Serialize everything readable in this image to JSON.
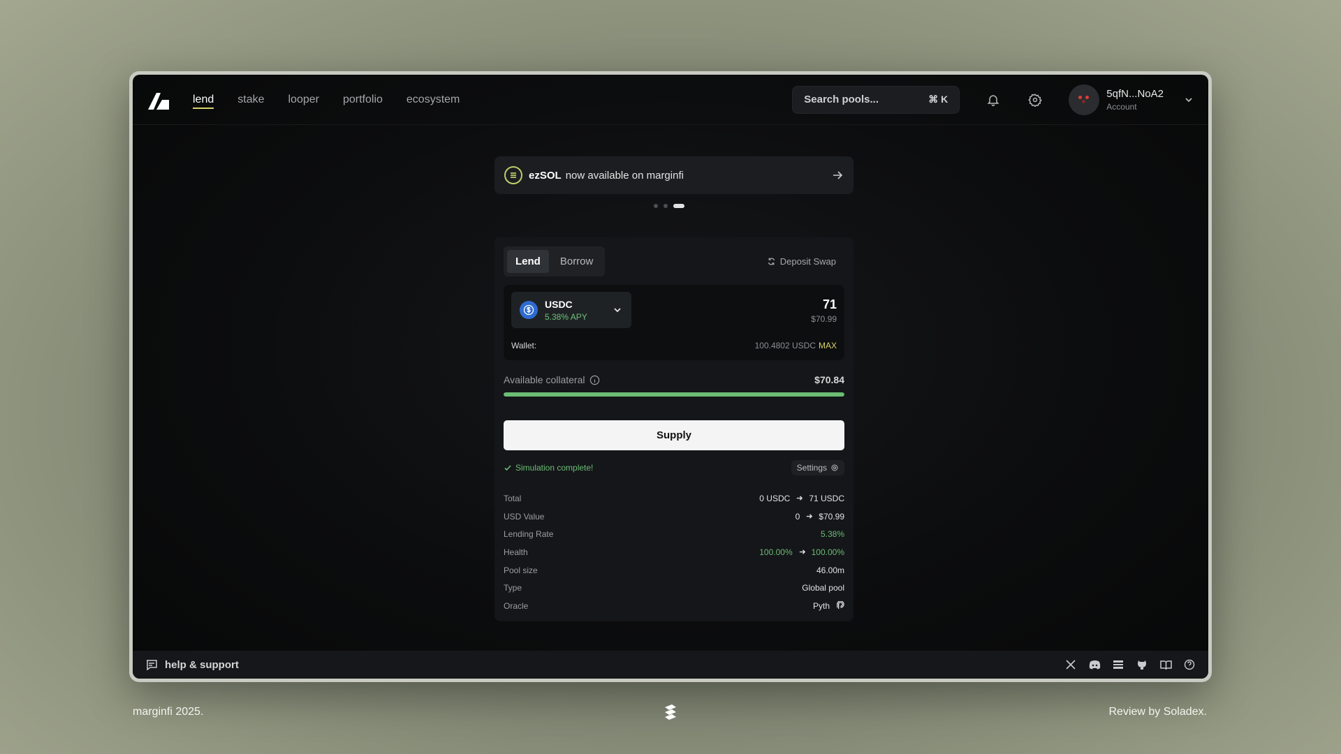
{
  "nav": {
    "items": [
      {
        "label": "lend",
        "active": true
      },
      {
        "label": "stake"
      },
      {
        "label": "looper"
      },
      {
        "label": "portfolio"
      },
      {
        "label": "ecosystem"
      }
    ],
    "search_placeholder": "Search pools...",
    "search_shortcut": "⌘ K",
    "account_name": "5qfN...NoA2",
    "account_sub": "Account"
  },
  "banner": {
    "token": "ezSOL",
    "text": "now available on marginfi"
  },
  "card": {
    "tabs": [
      "Lend",
      "Borrow"
    ],
    "deposit_swap": "Deposit Swap",
    "token": {
      "symbol": "USDC",
      "apy": "5.38% APY"
    },
    "amount": "71",
    "amount_usd": "$70.99",
    "wallet_label": "Wallet:",
    "wallet_balance": "100.4802 USDC",
    "max": "MAX",
    "collateral_label": "Available collateral",
    "collateral_value": "$70.84",
    "collateral_fill_fraction": 1.0,
    "supply_label": "Supply",
    "sim_status": "Simulation complete!",
    "settings_label": "Settings",
    "stats": {
      "total_label": "Total",
      "total_from": "0 USDC",
      "total_to": "71 USDC",
      "usd_label": "USD Value",
      "usd_from": "0",
      "usd_to": "$70.99",
      "rate_label": "Lending Rate",
      "rate_value": "5.38%",
      "health_label": "Health",
      "health_from": "100.00%",
      "health_to": "100.00%",
      "pool_label": "Pool size",
      "pool_value": "46.00m",
      "type_label": "Type",
      "type_value": "Global pool",
      "oracle_label": "Oracle",
      "oracle_value": "Pyth"
    }
  },
  "footer": {
    "help": "help & support"
  },
  "page": {
    "left": "marginfi 2025.",
    "right": "Review by Soladex."
  },
  "colors": {
    "accent_yellow": "#d8d36a",
    "green": "#6cbd75",
    "usdc_blue": "#2e6bd1"
  }
}
